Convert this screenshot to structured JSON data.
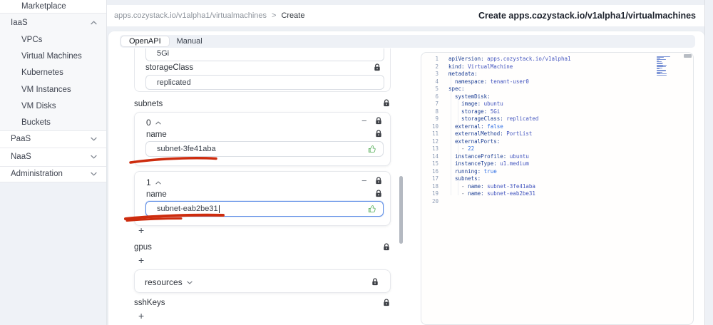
{
  "colors": {
    "accent_focus": "#5b8be5",
    "annotation_red": "#cd2c0e",
    "thumb_green": "#69b76d",
    "code_key": "#1d3f94",
    "code_string": "#4355bf",
    "code_keyword": "#2f6fe4",
    "code_plain": "#56617a",
    "lock_icon": "#3c3f45"
  },
  "sidebar": {
    "items": [
      {
        "label": "Marketplace",
        "type": "link"
      },
      {
        "label": "IaaS",
        "type": "section",
        "state": "expanded",
        "children": [
          "VPCs",
          "Virtual Machines",
          "Kubernetes",
          "VM Instances",
          "VM Disks",
          "Buckets"
        ]
      },
      {
        "label": "PaaS",
        "type": "section",
        "state": "collapsed",
        "children": []
      },
      {
        "label": "NaaS",
        "type": "section",
        "state": "collapsed",
        "children": []
      },
      {
        "label": "Administration",
        "type": "section",
        "state": "collapsed",
        "children": []
      }
    ]
  },
  "header": {
    "breadcrumb": {
      "path": "apps.cozystack.io/v1alpha1/virtualmachines",
      "separator": ">",
      "current": "Create"
    },
    "back_arrow": "←",
    "title": "Create apps.cozystack.io/v1alpha1/virtualmachines"
  },
  "tabs": [
    {
      "label": "OpenAPI",
      "active": true
    },
    {
      "label": "Manual",
      "active": false
    }
  ],
  "form": {
    "cutoff_input_value": "5Gi",
    "storage_class": {
      "label": "storageClass",
      "value": "replicated"
    },
    "subnets": {
      "label": "subnets",
      "remove_label": "−",
      "add_label": "+",
      "items": [
        {
          "index": "0",
          "field_label": "name",
          "value": "subnet-3fe41aba",
          "focused": false
        },
        {
          "index": "1",
          "field_label": "name",
          "value": "subnet-eab2be31",
          "focused": true
        }
      ]
    },
    "gpus": {
      "label": "gpus",
      "add_label": "+"
    },
    "resources": {
      "label": "resources"
    },
    "ssh_keys": {
      "label": "sshKeys",
      "add_label": "+"
    }
  },
  "editor": {
    "lines": [
      {
        "n": 1,
        "tokens": [
          [
            "key",
            "apiVersion:"
          ],
          [
            "str",
            " apps.cozystack.io/v1alpha1"
          ]
        ]
      },
      {
        "n": 2,
        "tokens": [
          [
            "key",
            "kind:"
          ],
          [
            "str",
            " VirtualMachine"
          ]
        ]
      },
      {
        "n": 3,
        "tokens": [
          [
            "key",
            "metadata:"
          ]
        ]
      },
      {
        "n": 4,
        "tokens": [
          [
            "key",
            "  namespace:"
          ],
          [
            "str",
            " tenant-user0"
          ]
        ]
      },
      {
        "n": 5,
        "tokens": [
          [
            "key",
            "spec:"
          ]
        ]
      },
      {
        "n": 6,
        "tokens": [
          [
            "key",
            "  systemDisk:"
          ]
        ]
      },
      {
        "n": 7,
        "tokens": [
          [
            "key",
            "    image:"
          ],
          [
            "str",
            " ubuntu"
          ]
        ]
      },
      {
        "n": 8,
        "tokens": [
          [
            "key",
            "    storage:"
          ],
          [
            "str",
            " 5Gi"
          ]
        ]
      },
      {
        "n": 9,
        "tokens": [
          [
            "key",
            "    storageClass:"
          ],
          [
            "str",
            " replicated"
          ]
        ]
      },
      {
        "n": 10,
        "tokens": [
          [
            "key",
            "  external:"
          ],
          [
            "kw",
            " false"
          ]
        ]
      },
      {
        "n": 11,
        "tokens": [
          [
            "key",
            "  externalMethod:"
          ],
          [
            "str",
            " PortList"
          ]
        ]
      },
      {
        "n": 12,
        "tokens": [
          [
            "key",
            "  externalPorts:"
          ]
        ]
      },
      {
        "n": 13,
        "tokens": [
          [
            "plain",
            "    - "
          ],
          [
            "kw",
            "22"
          ]
        ]
      },
      {
        "n": 14,
        "tokens": [
          [
            "key",
            "  instanceProfile:"
          ],
          [
            "str",
            " ubuntu"
          ]
        ]
      },
      {
        "n": 15,
        "tokens": [
          [
            "key",
            "  instanceType:"
          ],
          [
            "str",
            " u1.medium"
          ]
        ]
      },
      {
        "n": 16,
        "tokens": [
          [
            "key",
            "  running:"
          ],
          [
            "kw",
            " true"
          ]
        ]
      },
      {
        "n": 17,
        "tokens": [
          [
            "key",
            "  subnets:"
          ]
        ]
      },
      {
        "n": 18,
        "tokens": [
          [
            "plain",
            "    - "
          ],
          [
            "key",
            "name:"
          ],
          [
            "str",
            " subnet-3fe41aba"
          ]
        ]
      },
      {
        "n": 19,
        "tokens": [
          [
            "plain",
            "    - "
          ],
          [
            "key",
            "name:"
          ],
          [
            "str",
            " subnet-eab2be31"
          ]
        ]
      },
      {
        "n": 20,
        "tokens": []
      }
    ]
  }
}
